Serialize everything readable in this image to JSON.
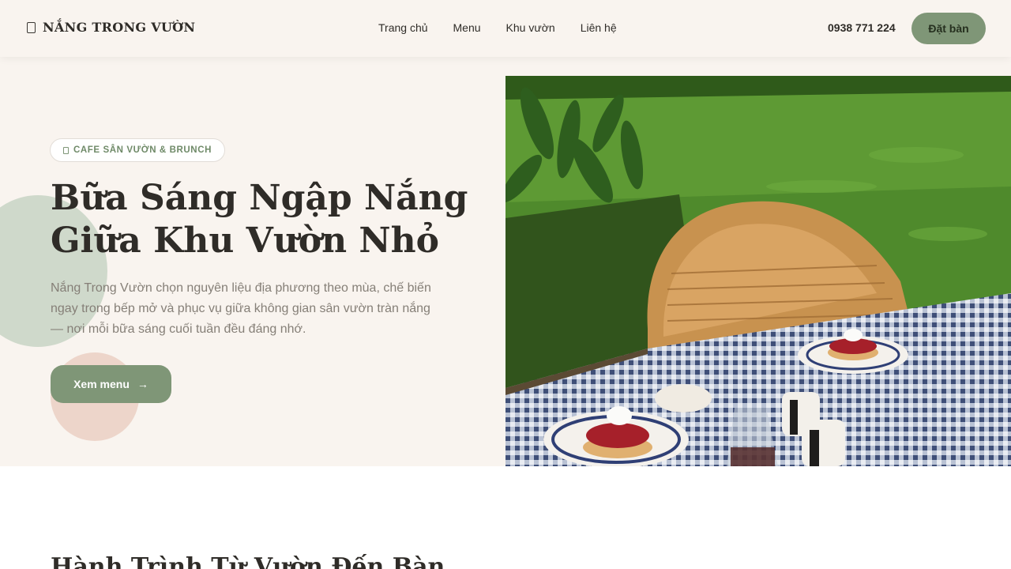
{
  "header": {
    "brand_icon": "leaf-icon",
    "brand_name": "NẮNG TRONG VƯỜN",
    "nav": [
      {
        "label": "Trang chủ"
      },
      {
        "label": "Menu"
      },
      {
        "label": "Khu vườn"
      },
      {
        "label": "Liên hệ"
      }
    ],
    "phone": "0938 771 224",
    "book_label": "Đặt bàn"
  },
  "hero": {
    "tag_icon": "leaf-icon",
    "tag": "CAFE SÂN VƯỜN & BRUNCH",
    "title_line1": "Bữa Sáng Ngập Nắng",
    "title_line2": "Giữa Khu Vườn Nhỏ",
    "description": "Nắng Trong Vườn chọn nguyên liệu địa phương theo mùa, chế biến ngay trong bếp mở và phục vụ giữa không gian sân vườn tràn nắng — nơi mỗi bữa sáng cuối tuần đều đáng nhớ.",
    "cta_label": "Xem menu",
    "cta_icon": "arrow-right-icon"
  },
  "next_section": {
    "title": "Hành Trình Từ Vườn Đến Bàn"
  },
  "colors": {
    "accent": "#7f9677",
    "background": "#f9f4ef",
    "text": "#2f2c28"
  }
}
